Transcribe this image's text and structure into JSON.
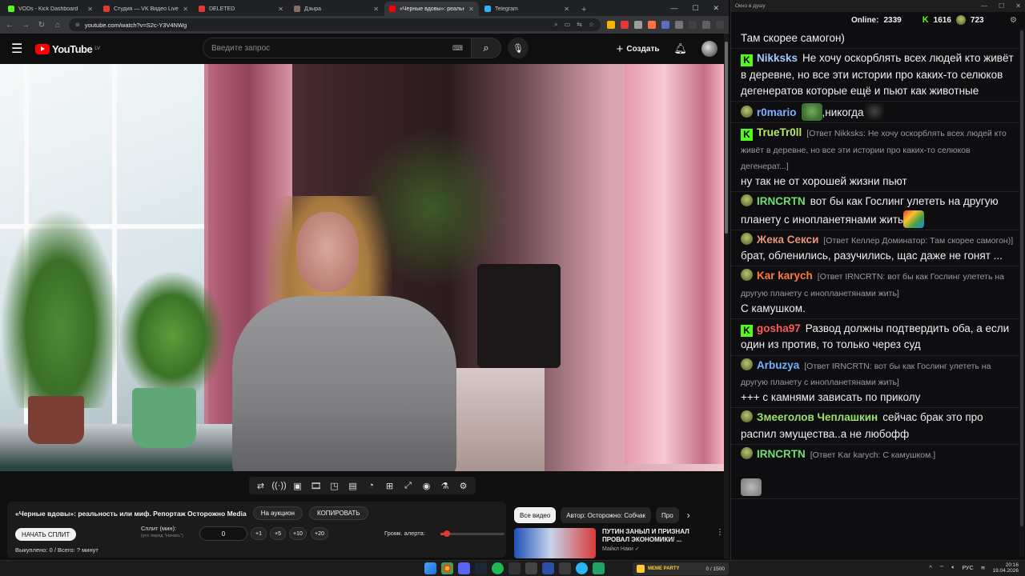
{
  "browser": {
    "tabs": [
      {
        "title": "VODs - Kick Dashboard",
        "color": "#53fc18",
        "active": false
      },
      {
        "title": "Студия — VK Видео Live",
        "color": "#e53935",
        "active": false
      },
      {
        "title": "DELETED",
        "color": "#e53935",
        "active": false
      },
      {
        "title": "Дзыра",
        "color": "#8d6e63",
        "active": false
      },
      {
        "title": "«Черные вдовы»: реальн",
        "color": "#ff0000",
        "active": true
      },
      {
        "title": "Telegram",
        "color": "#29b6f6",
        "active": false
      }
    ],
    "url": "youtube.com/watch?v=S2c-Y3V4NWg"
  },
  "youtube": {
    "logo_word": "YouTube",
    "logo_region": "LV",
    "search_placeholder": "Введите запрос",
    "create_label": "Создать"
  },
  "split": {
    "title": "«Черные вдовы»: реальность или миф. Репортаж Осторожно Media",
    "auction_label": "На аукцион",
    "copy_label": "КОПИРОВАТЬ",
    "start_label": "НАЧАТЬ СПЛИТ",
    "split_label": "Сплит (мин):",
    "split_sub": "(уст. перед \"Начать\")",
    "split_value": "0",
    "inc": [
      "+1",
      "+5",
      "+10",
      "+20"
    ],
    "alert_label": "Громк. алерта:",
    "alert_level": 0.1,
    "summary": "Выкуплено: 0 / Всего: ? минут"
  },
  "related": {
    "chips": [
      "Все видео",
      "Автор: Осторожно: Собчак",
      "Про"
    ],
    "video_title": "ПУТИН ЗАНЫЛ И ПРИЗНАЛ ПРОВАЛ ЭКОНОМИКИ/ ...",
    "video_channel": "Майкл Наки ✓"
  },
  "chat": {
    "window_title": "Окно в душу",
    "online_label": "Online:",
    "online_count": "2339",
    "kick_count": "1616",
    "pepe_count": "723",
    "messages": [
      {
        "user": "",
        "color": "#efeff1",
        "badge": "",
        "reply": "",
        "text": "Там скорее самогон)"
      },
      {
        "user": "Nikksks",
        "color": "#a1c8ff",
        "badge": "kick",
        "reply": "",
        "text": "Не хочу оскорблять всех людей кто живёт в деревне, но все эти истории про каких-то селюков дегенератов которые ещё и пьют как животные"
      },
      {
        "user": "r0mario",
        "color": "#7eb0ff",
        "badge": "pepe",
        "reply": "",
        "text": ",никогда"
      },
      {
        "user": "TrueTr0ll",
        "color": "#b5e96a",
        "badge": "kick",
        "reply": "[Ответ Nikksks: Не хочу оскорблять всех людей кто живёт в деревне, но все эти истории про каких-то селюков дегенерат...]",
        "text": "ну так не от хорошей жизни пьют"
      },
      {
        "user": "IRNCRTN",
        "color": "#6fe06f",
        "badge": "pepe",
        "reply": "",
        "text": "вот бы как Гослинг улететь на другую планету с инопланетянами жить"
      },
      {
        "user": "Жека Секси",
        "color": "#e8937a",
        "badge": "pepe",
        "reply": "[Ответ Келлер Доминатор: Там скорее самогон)]",
        "text": "брат, обленились, разучились, щас даже не гонят ..."
      },
      {
        "user": "Kar karych",
        "color": "#ff7b3a",
        "badge": "pepe",
        "reply": "[Ответ IRNCRTN: вот бы как Гослинг улететь на другую планету с инопланетянами жить]",
        "text": "С камушком."
      },
      {
        "user": "gosha97",
        "color": "#ff5a5a",
        "badge": "kick",
        "reply": "",
        "text": "Развод должны подтвердить оба, а если один из против, то только через суд"
      },
      {
        "user": "Arbuzya",
        "color": "#6fb3ff",
        "badge": "pepe",
        "reply": "[Ответ IRNCRTN: вот бы как Гослинг улететь на другую планету с инопланетянами жить]",
        "text": "+++ с камнями зависать по приколу"
      },
      {
        "user": "Змееголов Чеплашкин",
        "color": "#9be36b",
        "badge": "pepe",
        "reply": "",
        "text": "сейчас брак это про распил эмущества..а не любофф"
      },
      {
        "user": "IRNCRTN",
        "color": "#6fe06f",
        "badge": "pepe",
        "reply": "[Ответ Kar karych: С камушком.]",
        "text": ""
      }
    ]
  },
  "taskbar": {
    "widget_label": "MEME PARTY",
    "widget_count": "0 / 1500",
    "lang": "РУС",
    "time": "20:16",
    "date": "19.04.2026"
  }
}
